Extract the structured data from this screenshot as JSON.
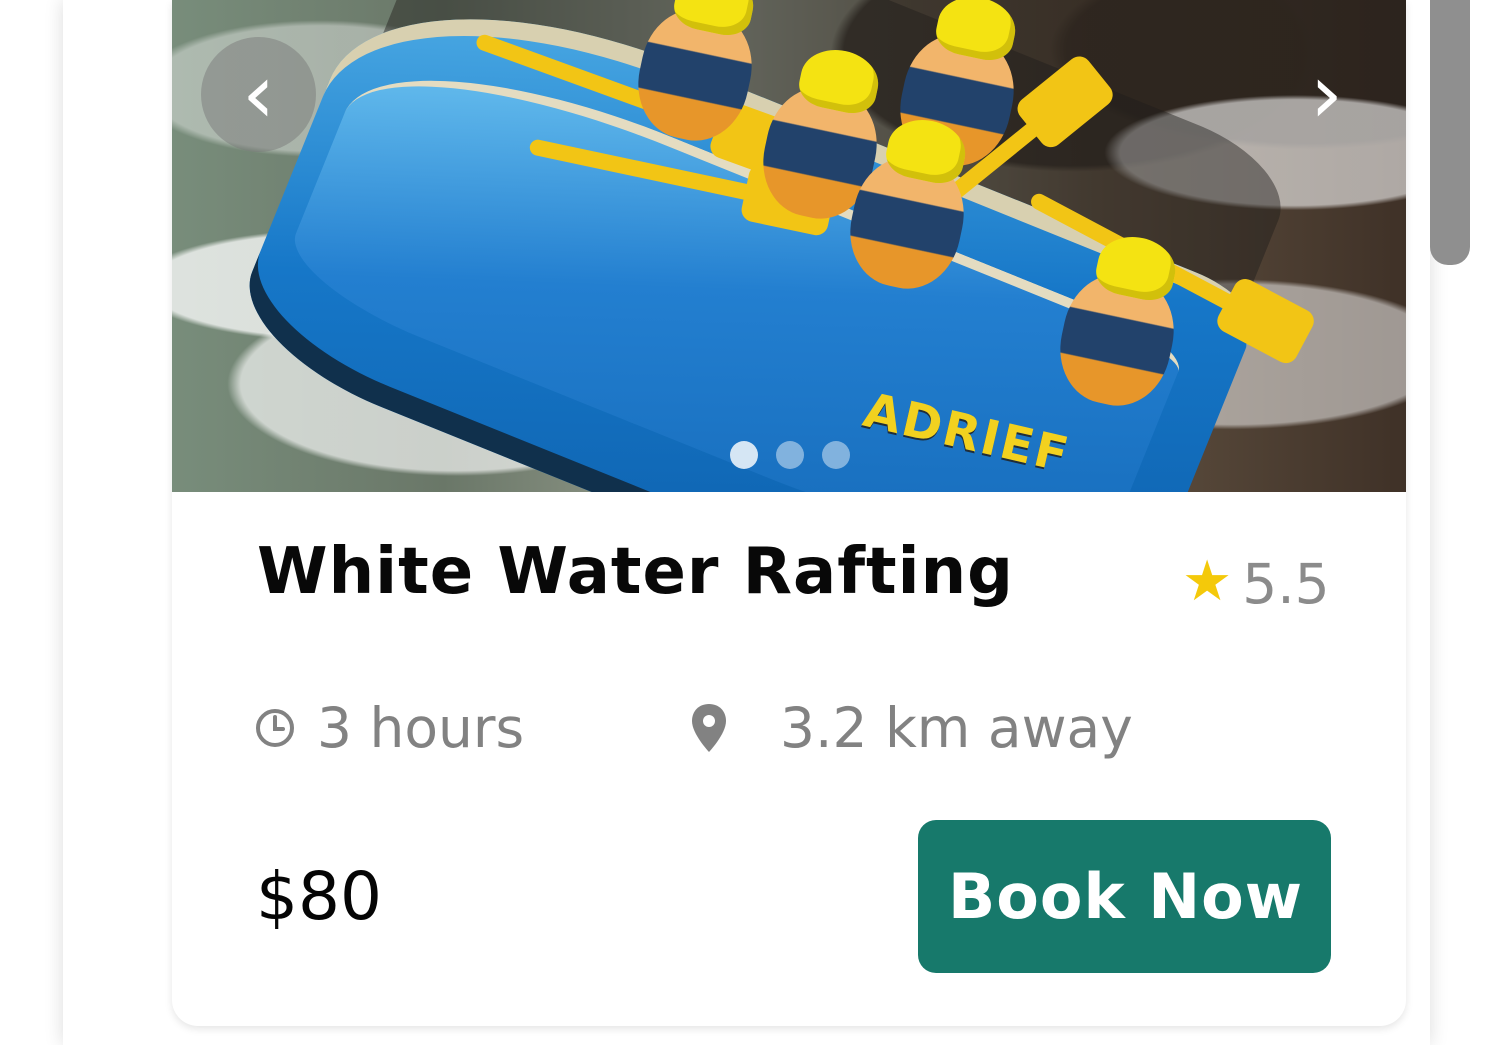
{
  "card": {
    "title": "White Water Rafting",
    "rating": "5.5",
    "duration": "3 hours",
    "distance": "3.2 km away",
    "price": "$80",
    "cta_label": "Book Now"
  },
  "carousel": {
    "prev_icon": "chevron-left-icon",
    "next_icon": "chevron-right-icon",
    "slide_count": 3,
    "active_slide": 1
  },
  "icons": {
    "rating": "star-icon",
    "duration": "clock-icon",
    "distance": "location-pin-icon"
  },
  "colors": {
    "accent": "#17796b",
    "rating_star": "#f4c90a",
    "muted_text": "#828282"
  }
}
